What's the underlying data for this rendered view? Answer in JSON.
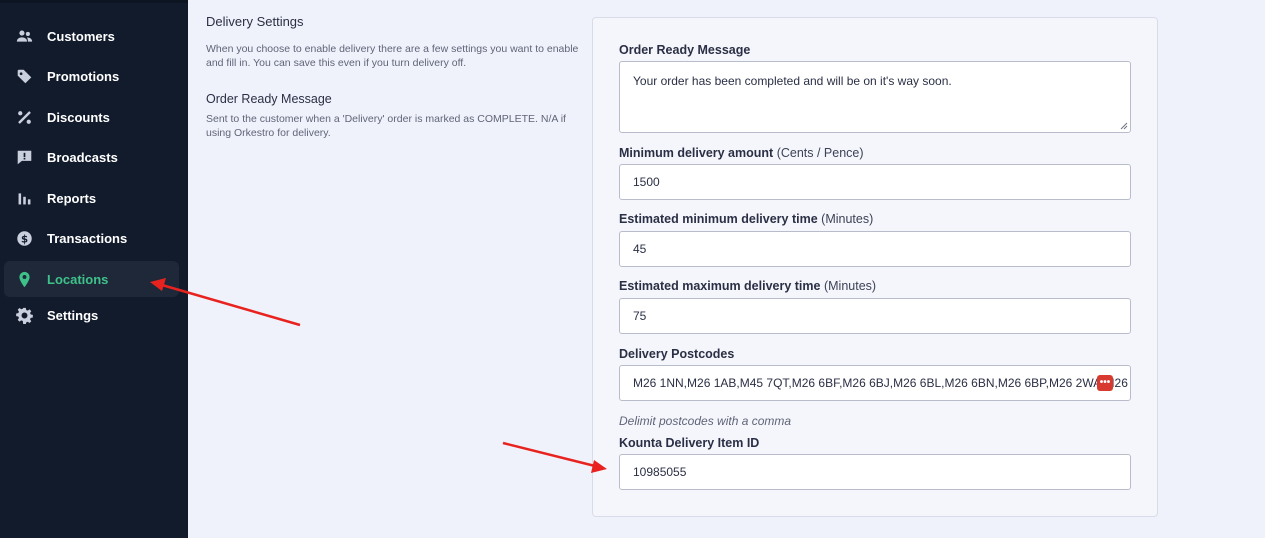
{
  "sidebar": {
    "items": [
      {
        "label": "Customers",
        "icon": "users-icon"
      },
      {
        "label": "Promotions",
        "icon": "tag-icon"
      },
      {
        "label": "Discounts",
        "icon": "percent-icon"
      },
      {
        "label": "Broadcasts",
        "icon": "message-icon"
      },
      {
        "label": "Reports",
        "icon": "bar-chart-icon"
      },
      {
        "label": "Transactions",
        "icon": "dollar-circle-icon"
      },
      {
        "label": "Locations",
        "icon": "map-pin-icon",
        "active": true
      },
      {
        "label": "Settings",
        "icon": "gear-icon"
      }
    ],
    "active_color": "#3ec28a"
  },
  "description": {
    "title": "Delivery Settings",
    "text": "When you choose to enable delivery there are a few settings you want to enable and fill in. You can save this even if you turn delivery off.",
    "sub_title": "Order Ready Message",
    "sub_text": "Sent to the customer when a 'Delivery' order is marked as COMPLETE. N/A if using Orkestro for delivery."
  },
  "form": {
    "order_ready": {
      "label": "Order Ready Message",
      "value": "Your order has been completed and will be on it's way soon."
    },
    "min_amount": {
      "label": "Minimum delivery amount",
      "unit": "(Cents / Pence)",
      "value": "1500"
    },
    "min_time": {
      "label": "Estimated minimum delivery time",
      "unit": "(Minutes)",
      "value": "45"
    },
    "max_time": {
      "label": "Estimated maximum delivery time",
      "unit": "(Minutes)",
      "value": "75"
    },
    "postcodes": {
      "label": "Delivery Postcodes",
      "value": "M26 1NN,M26 1AB,M45 7QT,M26 6BF,M26 6BJ,M26 6BL,M26 6BN,M26 6BP,M26 2WA,M26 2",
      "more_glyph": "•••",
      "helper": "Delimit postcodes with a comma"
    },
    "kounta": {
      "label": "Kounta Delivery Item ID",
      "value": "10985055"
    }
  },
  "annotations": {
    "arrow_color": "#e8231f"
  }
}
